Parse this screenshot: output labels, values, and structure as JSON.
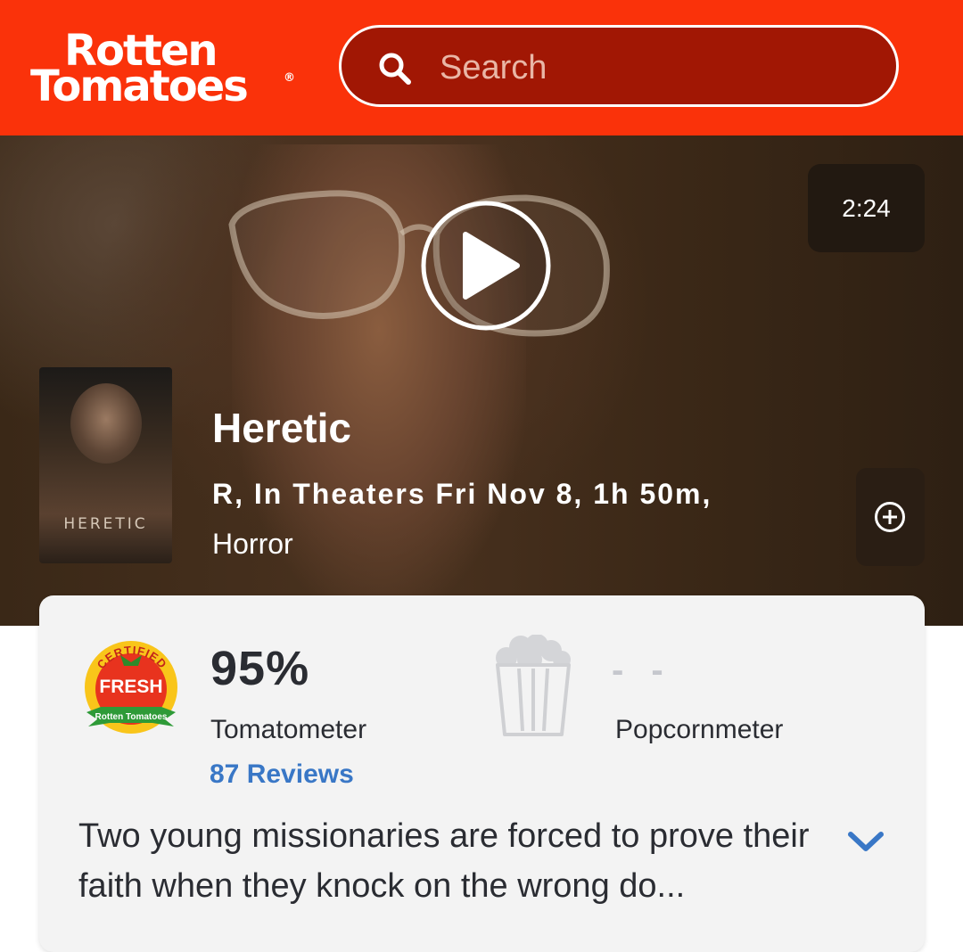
{
  "header": {
    "logo_line1": "Rotten",
    "logo_line2": "Tomatoes",
    "logo_reg": "®",
    "search_placeholder": "Search",
    "brand_color": "#fa320a"
  },
  "hero": {
    "duration": "2:24",
    "poster_title": "HERETIC",
    "title": "Heretic",
    "meta_line1": "R, In Theaters Fri Nov 8, 1h 50m,",
    "meta_line2": "Horror"
  },
  "scores": {
    "tomatometer": {
      "badge_top": "CERTIFIED",
      "badge_middle": "FRESH",
      "badge_bottom": "Rotten Tomatoes",
      "value": "95%",
      "label": "Tomatometer",
      "reviews": "87 Reviews"
    },
    "popcornmeter": {
      "value": "- -",
      "label": "Popcornmeter"
    }
  },
  "synopsis": "Two young missionaries are forced to prove their faith when they knock on the wrong do...",
  "icons": {
    "search": "search-icon",
    "play": "play-icon",
    "add": "plus-circle-icon",
    "popcorn": "popcorn-bucket-icon",
    "expand": "chevron-down-icon"
  }
}
